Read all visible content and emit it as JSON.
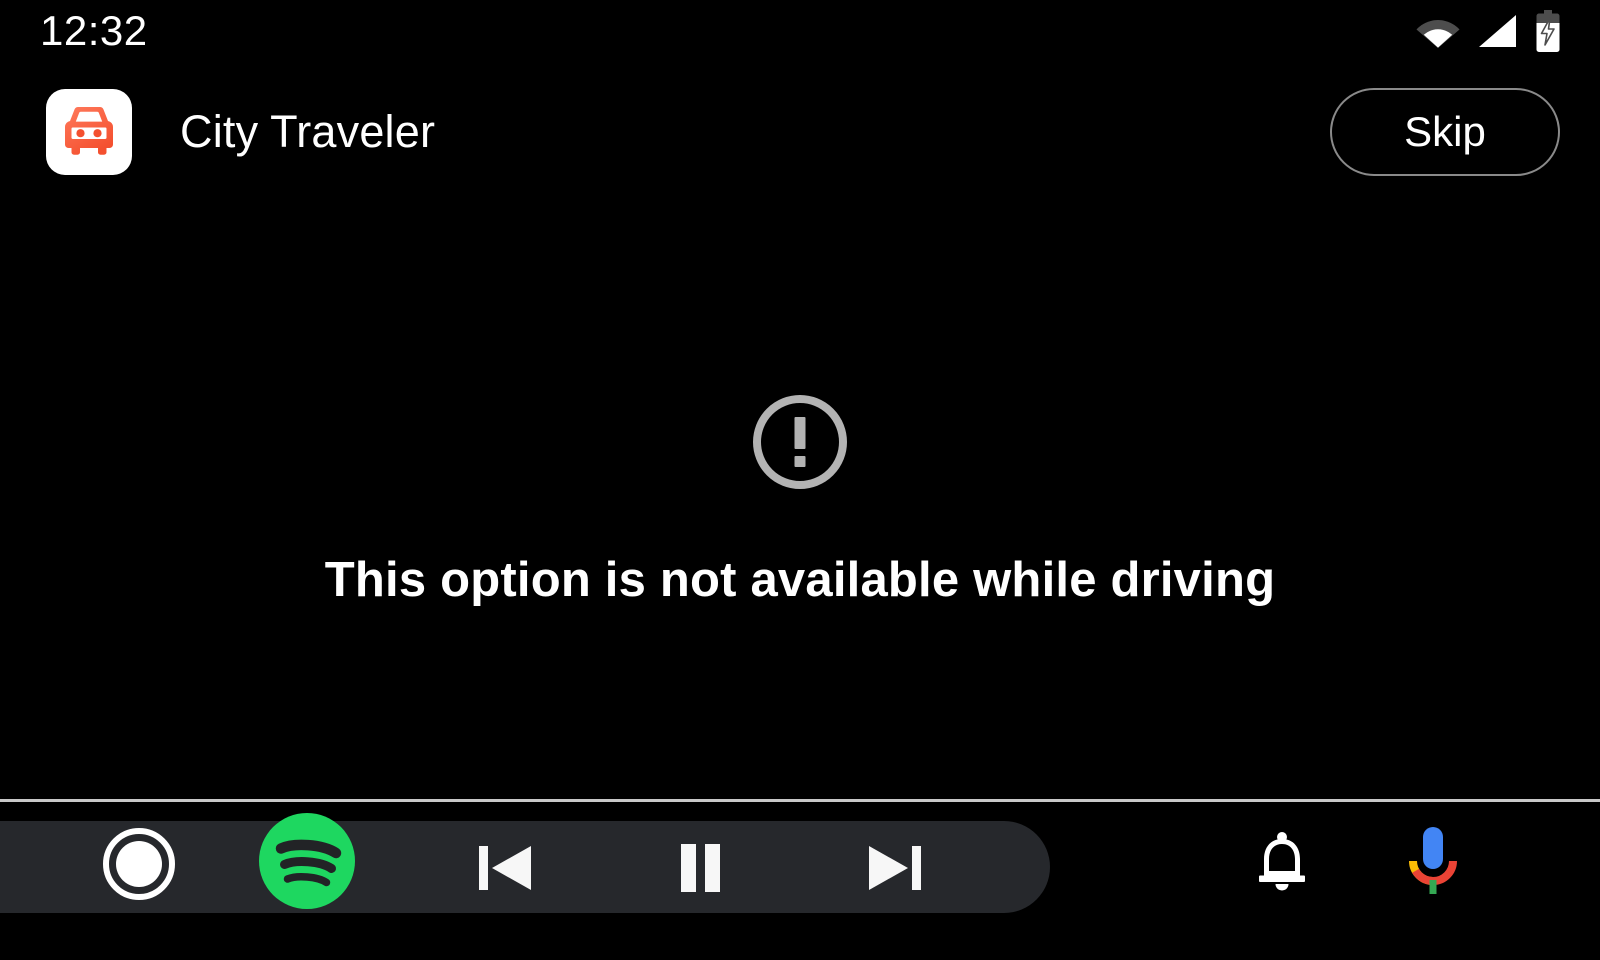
{
  "status_bar": {
    "clock": "12:32",
    "icons": [
      {
        "name": "wifi-icon",
        "label": "Wi-Fi"
      },
      {
        "name": "cellular-signal-icon",
        "label": "Cellular signal"
      },
      {
        "name": "battery-charging-icon",
        "label": "Battery charging"
      }
    ]
  },
  "header": {
    "app_icon_name": "car-icon",
    "app_title": "City Traveler",
    "skip_label": "Skip"
  },
  "main": {
    "warning_icon_name": "error-circle-icon",
    "message": "This option is not available while driving"
  },
  "nav_bar": {
    "home_label": "Home",
    "media_app_label": "Spotify",
    "previous_label": "Previous track",
    "pause_label": "Pause",
    "next_label": "Next track",
    "notifications_label": "Notifications",
    "assistant_label": "Google Assistant"
  },
  "colors": {
    "background": "#000000",
    "surface": "#26282c",
    "text_primary": "#ffffff",
    "outline": "#8a8a8a",
    "warning_gray": "#b3b3b3",
    "app_accent": "#f9603f",
    "spotify_green": "#1ed760",
    "divider": "#c8c8c8",
    "assistant_blue": "#4285f4",
    "assistant_red": "#ea4335",
    "assistant_yellow": "#fbbc05",
    "assistant_green": "#34a853"
  }
}
